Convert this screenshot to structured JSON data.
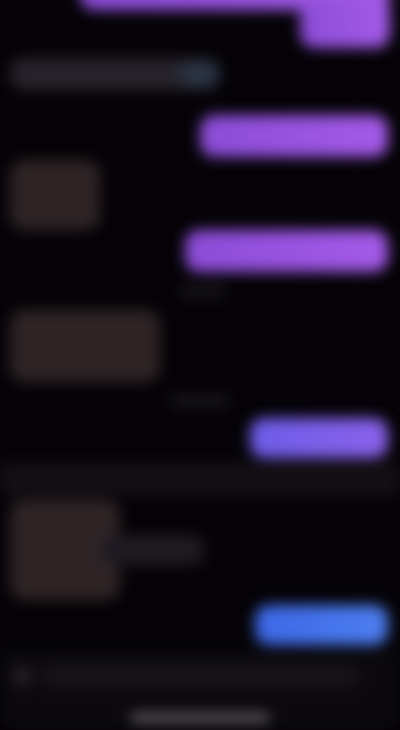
{
  "app": {
    "title": "",
    "theme_colors": {
      "background": "#050307",
      "outgoing_purple": "#a45ae8",
      "outgoing_violet": "#8a62ea",
      "outgoing_blue": "#4e7ef0",
      "incoming_gray": "#27232b"
    }
  },
  "conversation": {
    "messages": [
      {
        "direction": "outgoing",
        "text": ""
      },
      {
        "direction": "incoming",
        "text": ""
      },
      {
        "direction": "outgoing",
        "text": ""
      },
      {
        "direction": "incoming",
        "text": ""
      },
      {
        "direction": "outgoing",
        "text": ""
      },
      {
        "direction": "incoming",
        "text": ""
      },
      {
        "direction": "outgoing",
        "text": ""
      },
      {
        "direction": "incoming",
        "text": ""
      },
      {
        "direction": "outgoing",
        "text": ""
      }
    ],
    "timestamps": [
      "",
      ""
    ],
    "divider_text": ""
  },
  "composer": {
    "placeholder": ""
  }
}
